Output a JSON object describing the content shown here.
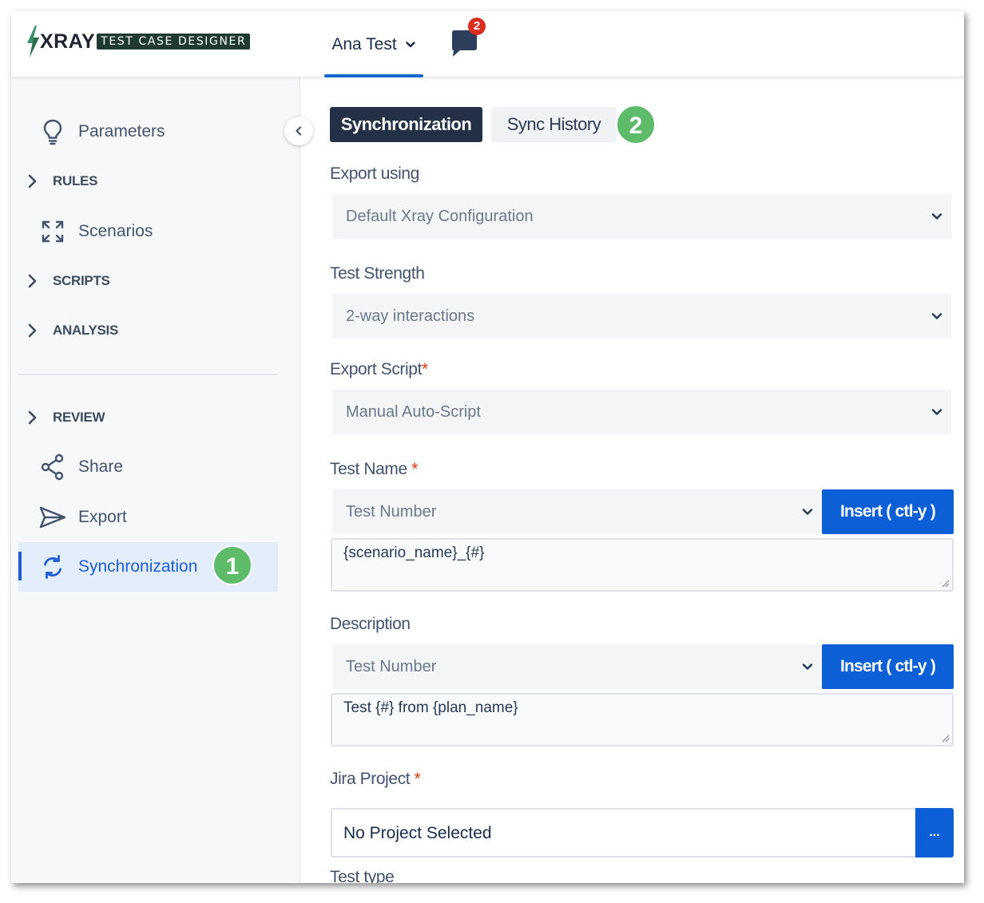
{
  "header": {
    "logo_word": "XRAY",
    "logo_badge": "TEST CASE DESIGNER",
    "user_name": "Ana Test",
    "notification_count": "2"
  },
  "sidebar": {
    "items": [
      {
        "label": "Parameters",
        "icon": "lightbulb-icon"
      },
      {
        "label": "RULES",
        "icon": "chevron-right-icon"
      },
      {
        "label": "Scenarios",
        "icon": "expand-icon"
      },
      {
        "label": "SCRIPTS",
        "icon": "chevron-right-icon"
      },
      {
        "label": "ANALYSIS",
        "icon": "chevron-right-icon"
      },
      {
        "label": "REVIEW",
        "icon": "chevron-right-icon"
      },
      {
        "label": "Share",
        "icon": "share-icon"
      },
      {
        "label": "Export",
        "icon": "send-icon"
      },
      {
        "label": "Synchronization",
        "icon": "sync-icon",
        "active": true
      }
    ],
    "callout": "1"
  },
  "main": {
    "tabs": [
      {
        "label": "Synchronization",
        "selected": true
      },
      {
        "label": "Sync History",
        "selected": false
      }
    ],
    "tabs_callout": "2",
    "export_using": {
      "label": "Export using",
      "value": "Default Xray Configuration"
    },
    "test_strength": {
      "label": "Test Strength",
      "value": "2-way interactions"
    },
    "export_script": {
      "label": "Export Script",
      "required_mark": "*",
      "value": "Manual Auto-Script"
    },
    "test_name": {
      "label": "Test Name",
      "required_mark": "*",
      "select_value": "Test Number",
      "insert_label": "Insert ( ctl-y )",
      "text": "{scenario_name}_{#}"
    },
    "description": {
      "label": "Description",
      "select_value": "Test Number",
      "insert_label": "Insert ( ctl-y )",
      "text": "Test {#} from {plan_name}"
    },
    "jira_project": {
      "label": "Jira Project",
      "required_mark": "*",
      "value": "No Project Selected",
      "button_label": "..."
    },
    "test_type": {
      "label": "Test type"
    }
  },
  "colors": {
    "accent": "#1b5dd6",
    "button_blue": "#0c5fd6",
    "tab_dark": "#243045",
    "callout_green": "#5dbb6a",
    "badge_red": "#d92d20"
  }
}
